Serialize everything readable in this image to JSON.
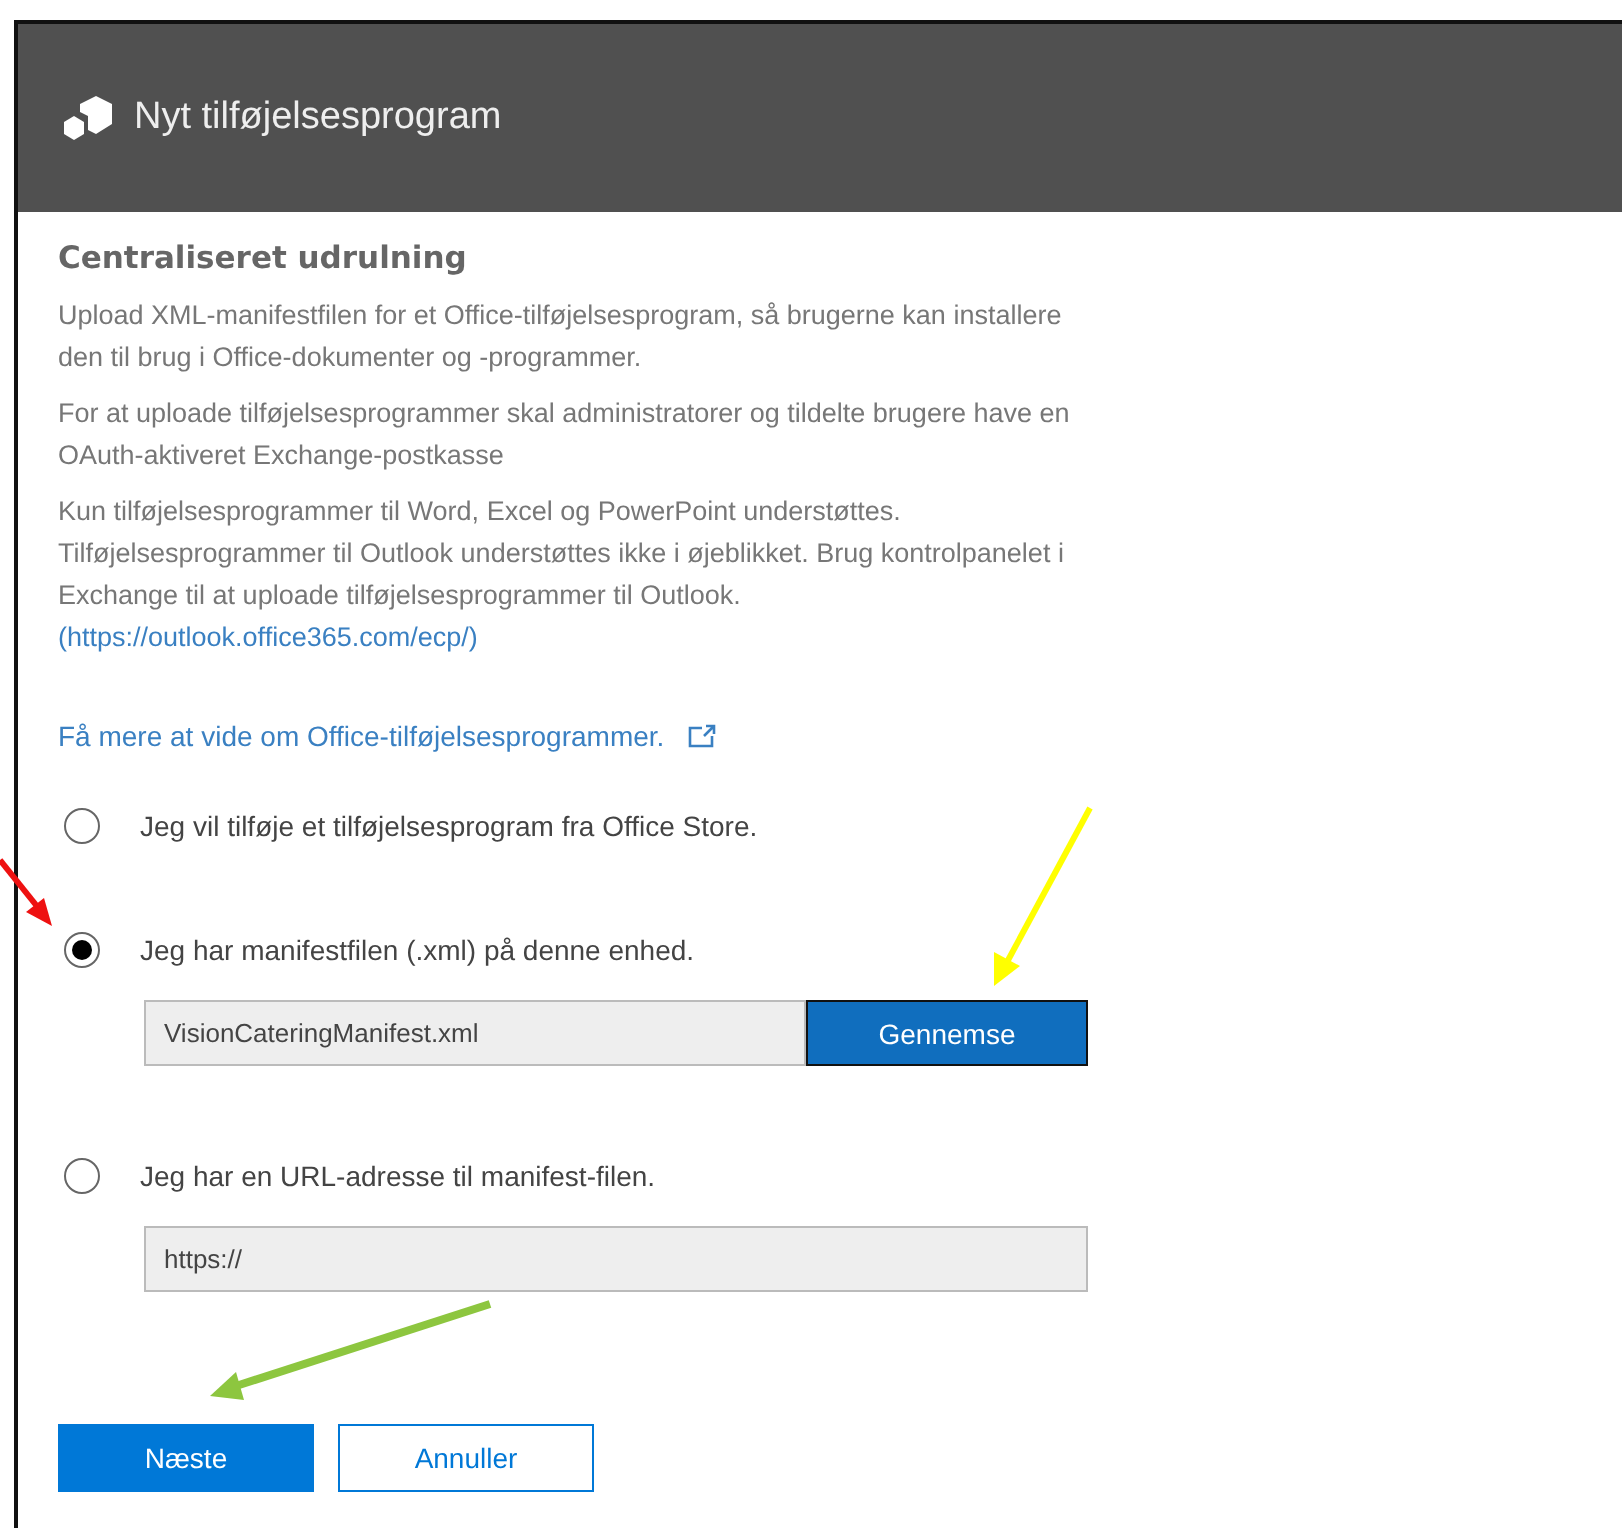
{
  "dialog": {
    "title": "Nyt tilføjelsesprogram",
    "heading": "Centraliseret udrulning",
    "paragraphs": [
      "Upload XML-manifestfilen for et Office-tilføjelsesprogram, så brugerne kan installere den til brug i Office-dokumenter og -programmer.",
      "For at uploade tilføjelsesprogrammer skal administratorer og tildelte brugere have en OAuth-aktiveret Exchange-postkasse"
    ],
    "note": {
      "text": "Kun tilføjelsesprogrammer til Word, Excel og PowerPoint understøttes. Tilføjelsesprogrammer til Outlook understøttes ikke i øjeblikket. Brug kontrolpanelet i Exchange til at uploade tilføjelsesprogrammer til Outlook.",
      "link": "(https://outlook.office365.com/ecp/)"
    },
    "learn_more": "Få mere at vide om Office-tilføjelsesprogrammer.",
    "options": [
      {
        "label": "Jeg vil tilføje et tilføjelsesprogram fra Office Store.",
        "selected": false
      },
      {
        "label": "Jeg har manifestfilen (.xml) på denne enhed.",
        "selected": true,
        "field": {
          "value": "VisionCateringManifest.xml",
          "button": "Gennemse"
        }
      },
      {
        "label": "Jeg har en URL-adresse til manifest-filen.",
        "selected": false,
        "field": {
          "value": "https://"
        }
      }
    ],
    "buttons": [
      {
        "label": "Næste",
        "kind": "primary"
      },
      {
        "label": "Annuller",
        "kind": "secondary"
      }
    ]
  }
}
